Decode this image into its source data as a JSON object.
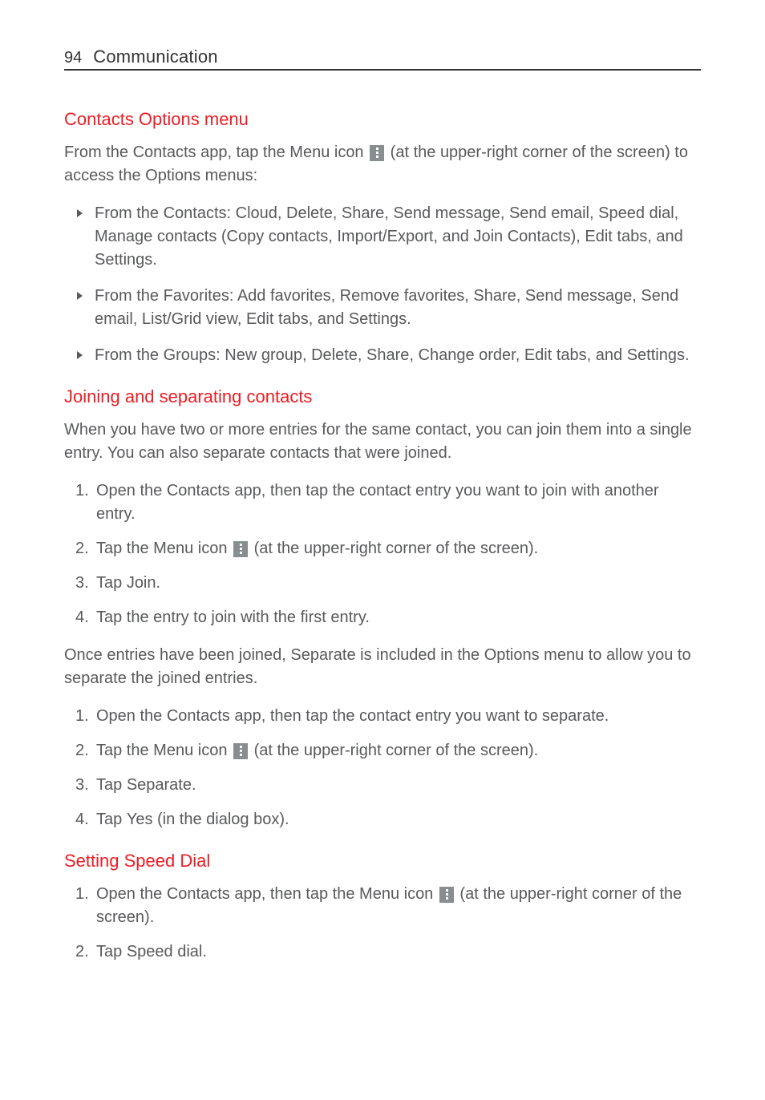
{
  "header": {
    "page_number": "94",
    "title": "Communication"
  },
  "s1": {
    "heading": "Contacts Options menu",
    "intro_a": "From the ",
    "intro_b": " app, tap the ",
    "intro_c": " icon ",
    "intro_d": " (at the upper-right corner of the screen) to access the Options menus:",
    "bold_contacts": "Contacts",
    "bold_menu": "Menu",
    "b1_a": "From the ",
    "b1_b": ": Cloud, Delete, Share, Send message, Send email, Speed dial, Manage contacts (Copy contacts, Import/Export, and Join Contacts), Edit tabs, and Settings.",
    "b1_bold": "Contacts",
    "b2_a": "From the ",
    "b2_b": ": Add favorites, Remove favorites, Share, Send message, Send email, List/Grid view, Edit tabs, and Settings.",
    "b2_bold": "Favorites",
    "b3_a": "From the ",
    "b3_b": ": New group, Delete, Share, Change order, Edit tabs, and Settings.",
    "b3_bold": "Groups"
  },
  "s2": {
    "heading": "Joining and separating contacts",
    "intro": "When you have two or more entries for the same contact, you can join them into a single entry. You can also separate contacts that were joined.",
    "n1_a": "Open the ",
    "n1_b": " app, then tap the contact entry you want to join with another entry.",
    "n1_bold": "Contacts",
    "n2_a": "Tap the ",
    "n2_b": " icon ",
    "n2_c": " (at the upper-right corner of the screen).",
    "n2_bold": "Menu",
    "n3_a": "Tap ",
    "n3_b": ".",
    "n3_bold": "Join",
    "n4": "Tap the entry to join with the first entry.",
    "mid_a": "Once entries have been joined, ",
    "mid_b": " is included in the Options menu to allow you to separate the joined entries.",
    "mid_bold": "Separate",
    "m1_a": "Open the ",
    "m1_b": " app, then tap the contact entry you want to separate.",
    "m1_bold": "Contacts",
    "m2_a": "Tap the ",
    "m2_b": " icon ",
    "m2_c": " (at the upper-right corner of the screen).",
    "m2_bold": "Menu",
    "m3_a": "Tap ",
    "m3_b": ".",
    "m3_bold": "Separate",
    "m4_a": "Tap ",
    "m4_b": " (in the dialog box).",
    "m4_bold": "Yes"
  },
  "s3": {
    "heading": "Setting Speed Dial",
    "n1_a": "Open the ",
    "n1_b": " app, then tap the ",
    "n1_c": " icon ",
    "n1_d": " (at the upper-right corner of the screen).",
    "n1_bold1": "Contacts",
    "n1_bold2": "Menu",
    "n2_a": "Tap ",
    "n2_b": ".",
    "n2_bold": "Speed dial"
  },
  "nums": {
    "n1": "1.",
    "n2": "2.",
    "n3": "3.",
    "n4": "4."
  }
}
